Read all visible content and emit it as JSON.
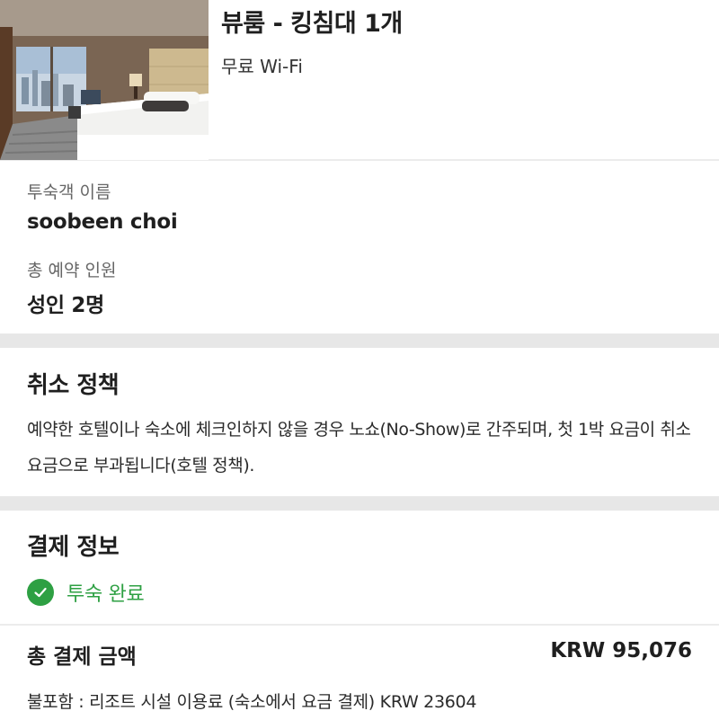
{
  "room": {
    "title": "뷰룸 - 킹침대 1개",
    "amenity": "무료 Wi-Fi",
    "photo_icon": "hotel-room-photo"
  },
  "guest": {
    "name_label": "투숙객 이름",
    "name_value": "soobeen choi",
    "count_label": "총 예약 인원",
    "count_value": "성인 2명"
  },
  "cancellation": {
    "title": "취소 정책",
    "text": "예약한 호텔이나 숙소에 체크인하지 않을 경우 노쇼(No-Show)로 간주되며, 첫 1박 요금이 취소 요금으로 부과됩니다(호텔 정책)."
  },
  "payment": {
    "title": "결제 정보",
    "status_text": "투숙 완료",
    "status_icon": "check-circle-icon",
    "status_color": "#2ea043",
    "total_label": "총 결제 금액",
    "total_amount": "KRW 95,076",
    "excluded_note": "불포함 : 리조트 시설 이용료 (숙소에서 요금 결제) KRW 23604"
  }
}
